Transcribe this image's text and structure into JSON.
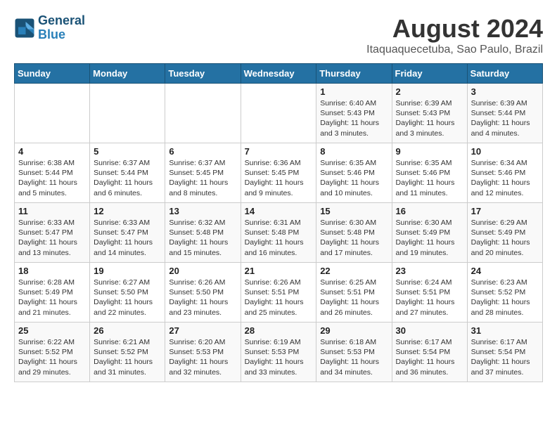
{
  "header": {
    "logo_line1": "General",
    "logo_line2": "Blue",
    "month_title": "August 2024",
    "location": "Itaquaquecetuba, Sao Paulo, Brazil"
  },
  "weekdays": [
    "Sunday",
    "Monday",
    "Tuesday",
    "Wednesday",
    "Thursday",
    "Friday",
    "Saturday"
  ],
  "weeks": [
    [
      {
        "day": "",
        "sunrise": "",
        "sunset": "",
        "daylight": ""
      },
      {
        "day": "",
        "sunrise": "",
        "sunset": "",
        "daylight": ""
      },
      {
        "day": "",
        "sunrise": "",
        "sunset": "",
        "daylight": ""
      },
      {
        "day": "",
        "sunrise": "",
        "sunset": "",
        "daylight": ""
      },
      {
        "day": "1",
        "sunrise": "6:40 AM",
        "sunset": "5:43 PM",
        "daylight": "11 hours and 3 minutes."
      },
      {
        "day": "2",
        "sunrise": "6:39 AM",
        "sunset": "5:43 PM",
        "daylight": "11 hours and 3 minutes."
      },
      {
        "day": "3",
        "sunrise": "6:39 AM",
        "sunset": "5:44 PM",
        "daylight": "11 hours and 4 minutes."
      }
    ],
    [
      {
        "day": "4",
        "sunrise": "6:38 AM",
        "sunset": "5:44 PM",
        "daylight": "11 hours and 5 minutes."
      },
      {
        "day": "5",
        "sunrise": "6:37 AM",
        "sunset": "5:44 PM",
        "daylight": "11 hours and 6 minutes."
      },
      {
        "day": "6",
        "sunrise": "6:37 AM",
        "sunset": "5:45 PM",
        "daylight": "11 hours and 8 minutes."
      },
      {
        "day": "7",
        "sunrise": "6:36 AM",
        "sunset": "5:45 PM",
        "daylight": "11 hours and 9 minutes."
      },
      {
        "day": "8",
        "sunrise": "6:35 AM",
        "sunset": "5:46 PM",
        "daylight": "11 hours and 10 minutes."
      },
      {
        "day": "9",
        "sunrise": "6:35 AM",
        "sunset": "5:46 PM",
        "daylight": "11 hours and 11 minutes."
      },
      {
        "day": "10",
        "sunrise": "6:34 AM",
        "sunset": "5:46 PM",
        "daylight": "11 hours and 12 minutes."
      }
    ],
    [
      {
        "day": "11",
        "sunrise": "6:33 AM",
        "sunset": "5:47 PM",
        "daylight": "11 hours and 13 minutes."
      },
      {
        "day": "12",
        "sunrise": "6:33 AM",
        "sunset": "5:47 PM",
        "daylight": "11 hours and 14 minutes."
      },
      {
        "day": "13",
        "sunrise": "6:32 AM",
        "sunset": "5:48 PM",
        "daylight": "11 hours and 15 minutes."
      },
      {
        "day": "14",
        "sunrise": "6:31 AM",
        "sunset": "5:48 PM",
        "daylight": "11 hours and 16 minutes."
      },
      {
        "day": "15",
        "sunrise": "6:30 AM",
        "sunset": "5:48 PM",
        "daylight": "11 hours and 17 minutes."
      },
      {
        "day": "16",
        "sunrise": "6:30 AM",
        "sunset": "5:49 PM",
        "daylight": "11 hours and 19 minutes."
      },
      {
        "day": "17",
        "sunrise": "6:29 AM",
        "sunset": "5:49 PM",
        "daylight": "11 hours and 20 minutes."
      }
    ],
    [
      {
        "day": "18",
        "sunrise": "6:28 AM",
        "sunset": "5:49 PM",
        "daylight": "11 hours and 21 minutes."
      },
      {
        "day": "19",
        "sunrise": "6:27 AM",
        "sunset": "5:50 PM",
        "daylight": "11 hours and 22 minutes."
      },
      {
        "day": "20",
        "sunrise": "6:26 AM",
        "sunset": "5:50 PM",
        "daylight": "11 hours and 23 minutes."
      },
      {
        "day": "21",
        "sunrise": "6:26 AM",
        "sunset": "5:51 PM",
        "daylight": "11 hours and 25 minutes."
      },
      {
        "day": "22",
        "sunrise": "6:25 AM",
        "sunset": "5:51 PM",
        "daylight": "11 hours and 26 minutes."
      },
      {
        "day": "23",
        "sunrise": "6:24 AM",
        "sunset": "5:51 PM",
        "daylight": "11 hours and 27 minutes."
      },
      {
        "day": "24",
        "sunrise": "6:23 AM",
        "sunset": "5:52 PM",
        "daylight": "11 hours and 28 minutes."
      }
    ],
    [
      {
        "day": "25",
        "sunrise": "6:22 AM",
        "sunset": "5:52 PM",
        "daylight": "11 hours and 29 minutes."
      },
      {
        "day": "26",
        "sunrise": "6:21 AM",
        "sunset": "5:52 PM",
        "daylight": "11 hours and 31 minutes."
      },
      {
        "day": "27",
        "sunrise": "6:20 AM",
        "sunset": "5:53 PM",
        "daylight": "11 hours and 32 minutes."
      },
      {
        "day": "28",
        "sunrise": "6:19 AM",
        "sunset": "5:53 PM",
        "daylight": "11 hours and 33 minutes."
      },
      {
        "day": "29",
        "sunrise": "6:18 AM",
        "sunset": "5:53 PM",
        "daylight": "11 hours and 34 minutes."
      },
      {
        "day": "30",
        "sunrise": "6:17 AM",
        "sunset": "5:54 PM",
        "daylight": "11 hours and 36 minutes."
      },
      {
        "day": "31",
        "sunrise": "6:17 AM",
        "sunset": "5:54 PM",
        "daylight": "11 hours and 37 minutes."
      }
    ]
  ]
}
